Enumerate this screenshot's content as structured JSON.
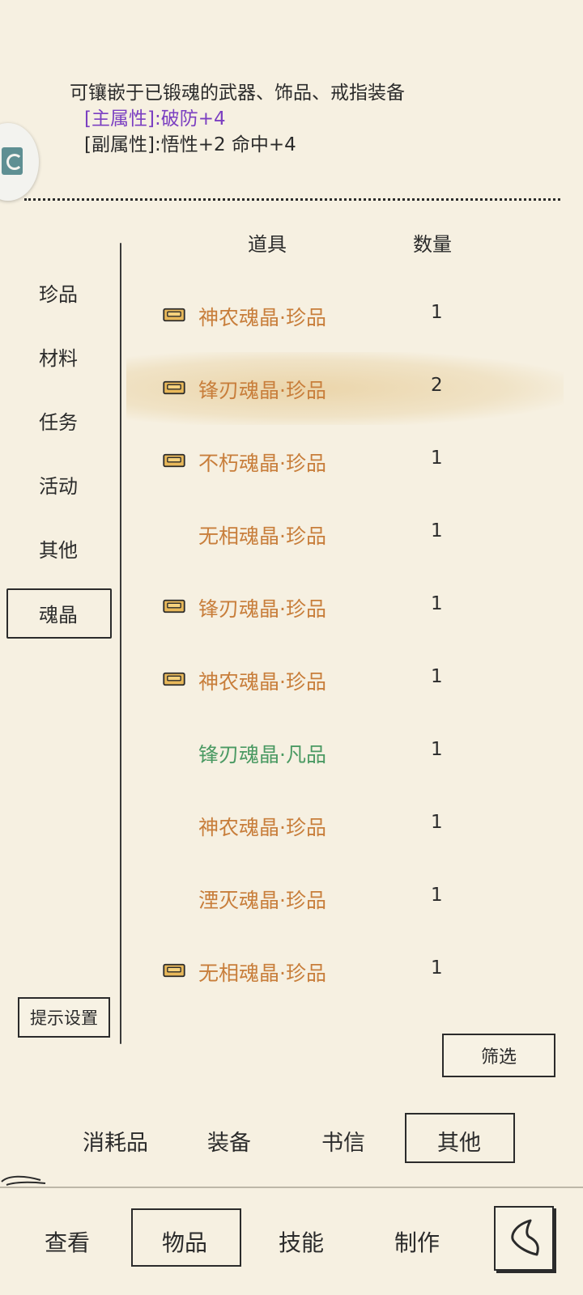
{
  "description": {
    "intro": "可镶嵌于已锻魂的武器、饰品、戒指装备",
    "main_attr": "[主属性]:破防+4",
    "sub_attr": "[副属性]:悟性+2 命中+4"
  },
  "table_header": {
    "item": "道具",
    "quantity": "数量"
  },
  "categories": [
    {
      "label": "珍品"
    },
    {
      "label": "材料"
    },
    {
      "label": "任务"
    },
    {
      "label": "活动"
    },
    {
      "label": "其他"
    },
    {
      "label": "魂晶",
      "selected": true
    }
  ],
  "items": [
    {
      "name": "神农魂晶·珍品",
      "qty": "1",
      "quality": "rare",
      "equipped": true
    },
    {
      "name": "锋刃魂晶·珍品",
      "qty": "2",
      "quality": "rare",
      "equipped": true,
      "selected": true
    },
    {
      "name": "不朽魂晶·珍品",
      "qty": "1",
      "quality": "rare",
      "equipped": true
    },
    {
      "name": "无相魂晶·珍品",
      "qty": "1",
      "quality": "rare",
      "equipped": false
    },
    {
      "name": "锋刃魂晶·珍品",
      "qty": "1",
      "quality": "rare",
      "equipped": true
    },
    {
      "name": "神农魂晶·珍品",
      "qty": "1",
      "quality": "rare",
      "equipped": true
    },
    {
      "name": "锋刃魂晶·凡品",
      "qty": "1",
      "quality": "common",
      "equipped": false
    },
    {
      "name": "神农魂晶·珍品",
      "qty": "1",
      "quality": "rare",
      "equipped": false
    },
    {
      "name": "湮灭魂晶·珍品",
      "qty": "1",
      "quality": "rare",
      "equipped": false
    },
    {
      "name": "无相魂晶·珍品",
      "qty": "1",
      "quality": "rare",
      "equipped": true
    }
  ],
  "buttons": {
    "hint_settings": "提示设置",
    "filter": "筛选"
  },
  "sub_tabs": [
    {
      "label": "消耗品"
    },
    {
      "label": "装备"
    },
    {
      "label": "书信"
    },
    {
      "label": "其他",
      "selected": true
    }
  ],
  "nav": [
    {
      "label": "查看"
    },
    {
      "label": "物品",
      "selected": true
    },
    {
      "label": "技能"
    },
    {
      "label": "制作"
    }
  ],
  "colors": {
    "background": "#f6f0e1",
    "rare": "#c87e3b",
    "common": "#4b9a63",
    "main_attr": "#7b3fc1",
    "ink": "#2b2b2b"
  }
}
